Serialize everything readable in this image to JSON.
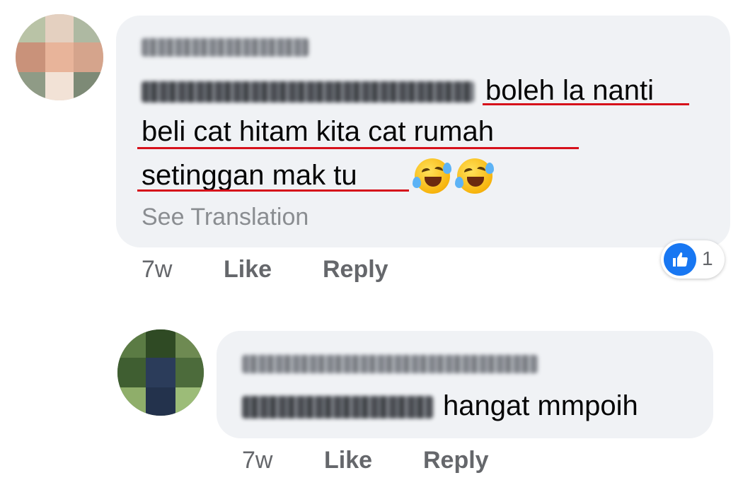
{
  "comment": {
    "text_lines": [
      "boleh la nanti",
      "beli cat hitam kita cat rumah",
      "setinggan mak tu"
    ],
    "emojis": [
      "rolling-on-floor-laughing",
      "rolling-on-floor-laughing"
    ],
    "see_translation": "See Translation",
    "time": "7w",
    "like_label": "Like",
    "reply_label": "Reply",
    "reaction_icon": "like-icon",
    "reaction_count": "1"
  },
  "reply": {
    "text": "hangat mmpoih",
    "time": "7w",
    "like_label": "Like",
    "reply_label": "Reply"
  },
  "colors": {
    "bubble": "#f0f2f5",
    "underline": "#d6111b",
    "like_blue": "#1877f2",
    "meta_text": "#65676b"
  }
}
